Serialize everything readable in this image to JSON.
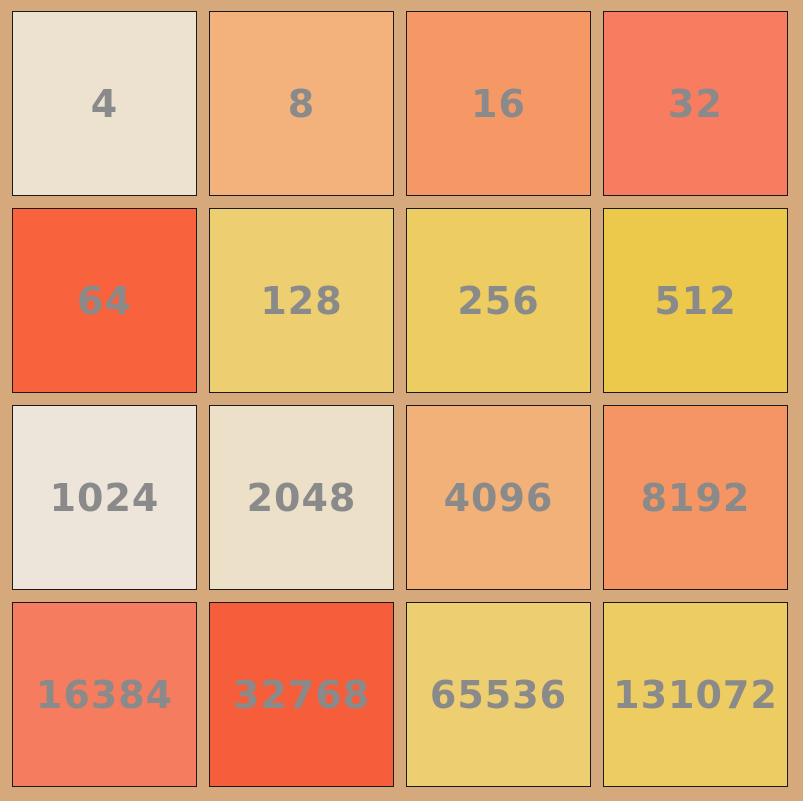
{
  "board": {
    "rows": 4,
    "cols": 4,
    "background_color": "#d5a97b",
    "number_color": "#8a8a8a"
  },
  "tiles": [
    {
      "value": "4",
      "color": "#ede2cf"
    },
    {
      "value": "8",
      "color": "#f3b17b"
    },
    {
      "value": "16",
      "color": "#f69866"
    },
    {
      "value": "32",
      "color": "#f77c60"
    },
    {
      "value": "64",
      "color": "#f8623c"
    },
    {
      "value": "128",
      "color": "#edcf72"
    },
    {
      "value": "256",
      "color": "#edcc62"
    },
    {
      "value": "512",
      "color": "#ecc94b"
    },
    {
      "value": "1024",
      "color": "#eee5da"
    },
    {
      "value": "2048",
      "color": "#ede0c8"
    },
    {
      "value": "4096",
      "color": "#f2b179"
    },
    {
      "value": "8192",
      "color": "#f59563"
    },
    {
      "value": "16384",
      "color": "#f67c5f"
    },
    {
      "value": "32768",
      "color": "#f65e3b"
    },
    {
      "value": "65536",
      "color": "#edcf72"
    },
    {
      "value": "131072",
      "color": "#edcc61"
    }
  ]
}
